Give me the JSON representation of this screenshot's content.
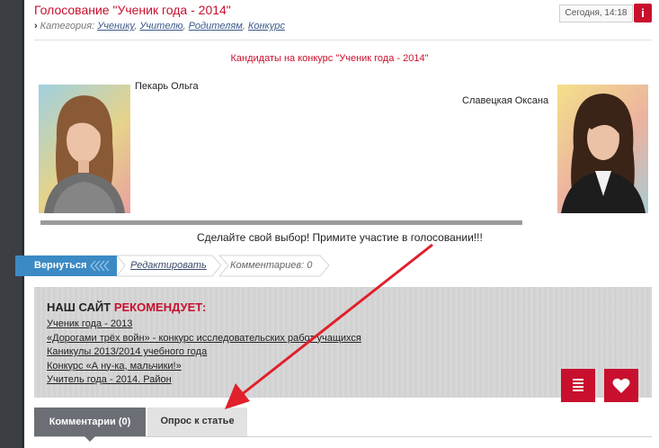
{
  "article": {
    "title": "Голосование \"Ученик года - 2014\"",
    "category_label": "Категория:",
    "categories": [
      "Ученику",
      "Учителю",
      "Родителям",
      "Конкурс"
    ],
    "date": "Сегодня, 14:18",
    "info_glyph": "i"
  },
  "content": {
    "candidates_heading": "Кандидаты на конкурс \"Ученик года - 2014\"",
    "candidate1_name": "Пекарь Ольга",
    "candidate2_name": "Славецкая Оксана",
    "call_to_action": "Сделайте свой выбор! Примите участие в голосовании!!!"
  },
  "actions": {
    "back_label": "Вернуться",
    "edit_label": "Редактировать",
    "comments_label": "Комментариев: 0"
  },
  "recommendations": {
    "title_prefix": "НАШ САЙТ",
    "title_highlight": "РЕКОМЕНДУЕТ:",
    "links": [
      "Ученик года - 2013",
      "«Дорогами трёх войн» - конкурс исследовательских работ учащихся",
      "Каникулы 2013/2014 учебного года",
      "Конкурс «А ну-ка, мальчики!»",
      "Учитель года - 2014. Район"
    ]
  },
  "tabs": {
    "comments": "Комментарии (0)",
    "poll": "Опрос к статье"
  },
  "colors": {
    "accent_red": "#c8102e",
    "back_blue": "#3b8ac4",
    "sidebar_dark": "#3b3f44",
    "annotation_arrow": "#e0202a"
  },
  "icons": {
    "list": "list-icon",
    "favorite": "heart-icon",
    "breadcrumb": "chevron-right-icon"
  }
}
